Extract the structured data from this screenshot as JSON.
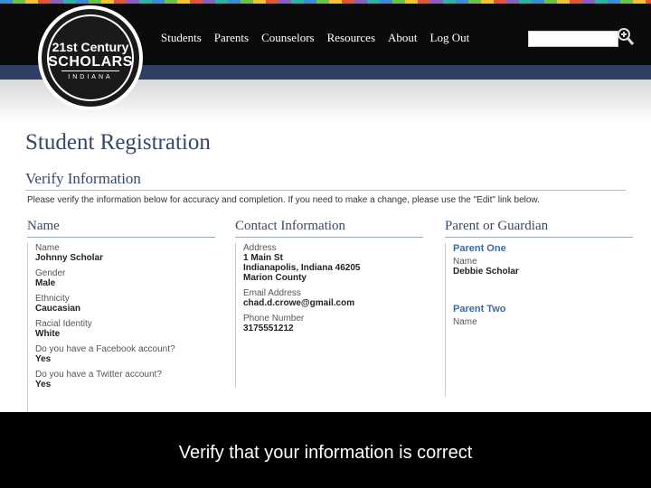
{
  "logo": {
    "line1": "21st Century",
    "line2": "SCHOLARS",
    "line3": "INDIANA"
  },
  "nav": {
    "items": [
      "Students",
      "Parents",
      "Counselors",
      "Resources",
      "About",
      "Log Out"
    ]
  },
  "search": {
    "placeholder": ""
  },
  "page": {
    "title": "Student Registration",
    "subtitle": "Verify Information",
    "instructions": "Please verify the information below for accuracy and completion. If you need to make a change, please use the \"Edit\" link below."
  },
  "name_col": {
    "heading": "Name",
    "fields": [
      {
        "label": "Name",
        "value": "Johnny Scholar"
      },
      {
        "label": "Gender",
        "value": "Male"
      },
      {
        "label": "Ethnicity",
        "value": "Caucasian"
      },
      {
        "label": "Racial Identity",
        "value": "White"
      },
      {
        "label": "Do you have a Facebook account?",
        "value": "Yes"
      },
      {
        "label": "Do you have a Twitter account?",
        "value": "Yes"
      }
    ]
  },
  "contact_col": {
    "heading": "Contact Information",
    "address_label": "Address",
    "address_lines": [
      "1 Main St",
      "Indianapolis, Indiana 46205",
      "Marion County"
    ],
    "email_label": "Email Address",
    "email_value": "chad.d.crowe@gmail.com",
    "phone_label": "Phone Number",
    "phone_value": "3175551212"
  },
  "parent_col": {
    "heading": "Parent or Guardian",
    "parent_one_title": "Parent One",
    "parent_one_label": "Name",
    "parent_one_value": "Debbie Scholar",
    "parent_two_title": "Parent Two",
    "parent_two_label": "Name"
  },
  "caption": "Verify that your information is correct"
}
